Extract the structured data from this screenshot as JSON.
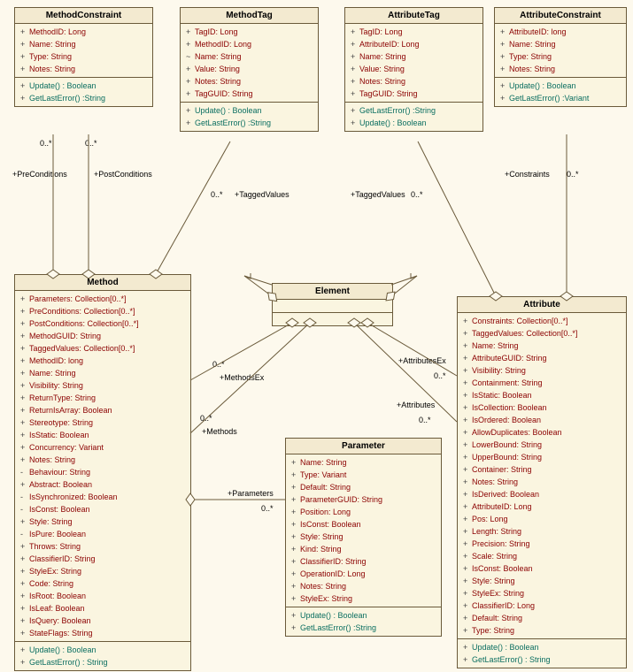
{
  "chart_data": {
    "type": "uml-class-diagram",
    "classes": [
      {
        "name": "MethodConstraint",
        "attributes": [
          "MethodID: Long",
          "Name: String",
          "Type: String",
          "Notes: String"
        ],
        "methods": [
          "Update() : Boolean",
          "GetLastError() :String"
        ]
      },
      {
        "name": "MethodTag",
        "attributes": [
          "TagID: Long",
          "MethodID: Long",
          "Name: String",
          "Value: String",
          "Notes: String",
          "TagGUID: String"
        ],
        "methods": [
          "Update() : Boolean",
          "GetLastError() :String"
        ]
      },
      {
        "name": "AttributeTag",
        "attributes": [
          "TagID: Long",
          "AttributeID: Long",
          "Name: String",
          "Value: String",
          "Notes: String",
          "TagGUID: String"
        ],
        "methods": [
          "GetLastError() :String",
          "Update() : Boolean"
        ]
      },
      {
        "name": "AttributeConstraint",
        "attributes": [
          "AttributeID: long",
          "Name: String",
          "Type: String",
          "Notes: String"
        ],
        "methods": [
          "Update() : Boolean",
          "GetLastError() :Variant"
        ]
      },
      {
        "name": "Method",
        "attributes": [
          "Parameters: Collection[0..*]",
          "PreConditions: Collection[0..*]",
          "PostConditions: Collection[0..*]",
          "MethodGUID: String",
          "TaggedValues: Collection[0..*]",
          "MethodID: long",
          "Name: String",
          "Visibility: String",
          "ReturnType: String",
          "ReturnIsArray: Boolean",
          "Stereotype: String",
          "IsStatic: Boolean",
          "Concurrency: Variant",
          "Notes: String",
          "Behaviour: String",
          "Abstract: Boolean",
          "IsSynchronized: Boolean",
          "IsConst: Boolean",
          "Style: String",
          "IsPure: Boolean",
          "Throws: String",
          "ClassifierID: String",
          "StyleEx: String",
          "Code: String",
          "IsRoot: Boolean",
          "IsLeaf: Boolean",
          "IsQuery: Boolean",
          "StateFlags: String"
        ],
        "methods": [
          "Update() : Boolean",
          "GetLastError() : String"
        ]
      },
      {
        "name": "Element",
        "attributes": [],
        "methods": []
      },
      {
        "name": "Parameter",
        "attributes": [
          "Name: String",
          "Type: Variant",
          "Default: String",
          "ParameterGUID: String",
          "Position: Long",
          "IsConst: Boolean",
          "Style: String",
          "Kind: String",
          "ClassifierID: String",
          "OperationID: Long",
          "Notes: String",
          "StyleEx: String"
        ],
        "methods": [
          "Update() : Boolean",
          "GetLastError() :String"
        ]
      },
      {
        "name": "Attribute",
        "attributes": [
          "Constraints: Collection[0..*]",
          "TaggedValues: Collection[0..*]",
          "Name: String",
          "AttributeGUID: String",
          "Visibility: String",
          "Containment: String",
          "IsStatic: Boolean",
          "IsCollection: Boolean",
          "IsOrdered: Boolean",
          "AllowDuplicates: Boolean",
          "LowerBound: String",
          "UpperBound: String",
          "Container: String",
          "Notes: String",
          "IsDerived: Boolean",
          "AttributeID: Long",
          "Pos: Long",
          "Length: String",
          "Precision: String",
          "Scale: String",
          "IsConst: Boolean",
          "Style: String",
          "StyleEx: String",
          "ClassifierID: Long",
          "Default: String",
          "Type: String"
        ],
        "methods": [
          "Update() : Boolean",
          "GetLastError() : String"
        ]
      }
    ],
    "associations": [
      {
        "from": "Method",
        "to": "MethodConstraint",
        "role": "PreConditions",
        "multiplicity": "0..*",
        "type": "aggregation"
      },
      {
        "from": "Method",
        "to": "MethodConstraint",
        "role": "PostConditions",
        "multiplicity": "0..*",
        "type": "aggregation"
      },
      {
        "from": "Method",
        "to": "MethodTag",
        "role": "TaggedValues",
        "multiplicity": "0..*",
        "type": "aggregation"
      },
      {
        "from": "Attribute",
        "to": "AttributeTag",
        "role": "TaggedValues",
        "multiplicity": "0..*",
        "type": "aggregation"
      },
      {
        "from": "Attribute",
        "to": "AttributeConstraint",
        "role": "Constraints",
        "multiplicity": "0..*",
        "type": "aggregation"
      },
      {
        "from": "Element",
        "to": "Method",
        "role": "MethodsEx",
        "multiplicity": "0..*",
        "type": "aggregation"
      },
      {
        "from": "Element",
        "to": "Method",
        "role": "Methods",
        "multiplicity": "0..*",
        "type": "aggregation"
      },
      {
        "from": "Element",
        "to": "Attribute",
        "role": "AttributesEx",
        "multiplicity": "0..*",
        "type": "aggregation"
      },
      {
        "from": "Element",
        "to": "Attribute",
        "role": "Attributes",
        "multiplicity": "0..*",
        "type": "aggregation"
      },
      {
        "from": "Element",
        "to": "Element",
        "role": "",
        "multiplicity": "",
        "type": "aggregation-self-left"
      },
      {
        "from": "Element",
        "to": "Element",
        "role": "",
        "multiplicity": "",
        "type": "aggregation-self-right"
      },
      {
        "from": "Method",
        "to": "Parameter",
        "role": "Parameters",
        "multiplicity": "0..*",
        "type": "aggregation"
      }
    ]
  },
  "labels": {
    "preCond": "+PreConditions",
    "postCond": "+PostConditions",
    "taggedVals": "+TaggedValues",
    "constraints": "+Constraints",
    "methodsEx": "+MethodsEx",
    "methods": "+Methods",
    "attrsEx": "+AttributesEx",
    "attrs": "+Attributes",
    "params": "+Parameters",
    "mult": "0..*"
  },
  "symbols": {
    "plus": "+",
    "tilde": "~",
    "minus": "-"
  }
}
